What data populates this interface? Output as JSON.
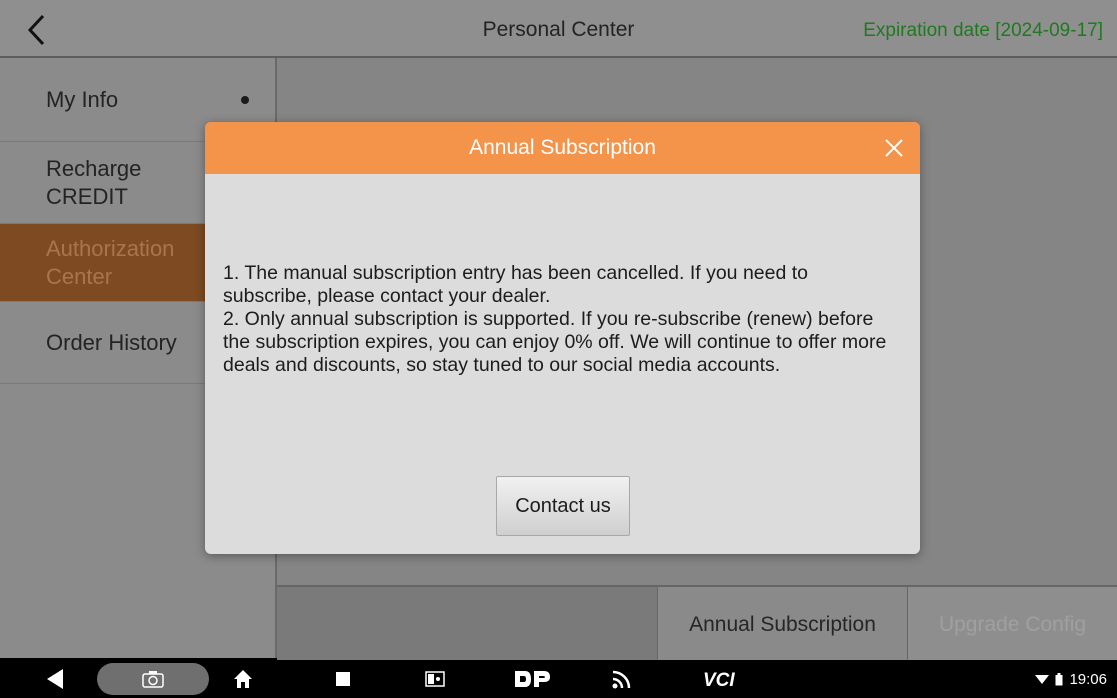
{
  "header": {
    "title": "Personal Center",
    "expiration": "Expiration date [2024-09-17]"
  },
  "sidebar": {
    "items": [
      {
        "label": "My Info",
        "has_dot": true
      },
      {
        "label": "Recharge\nCREDIT"
      },
      {
        "label": "Authorization\nCenter",
        "active": true
      },
      {
        "label": "Order History"
      }
    ]
  },
  "tabs": {
    "annual": "Annual Subscription",
    "upgrade": "Upgrade Config"
  },
  "dialog": {
    "title": "Annual Subscription",
    "paragraph1": "1. The manual subscription entry has been cancelled. If you need to subscribe, please contact your dealer.",
    "paragraph2": "2. Only annual subscription is supported. If you re-subscribe (renew) before the subscription expires, you can enjoy 0% off. We will continue to offer more deals and discounts, so stay tuned to our social media accounts.",
    "contact_button": "Contact us"
  },
  "navbar": {
    "vci_label": "VCI",
    "time": "19:06",
    "icons": [
      "back-triangle-icon",
      "camera-icon",
      "home-icon",
      "recent-apps-icon",
      "screen-mirror-icon",
      "dp-logo-icon",
      "cast-signal-icon",
      "vci-icon",
      "wifi-icon",
      "battery-icon"
    ]
  },
  "colors": {
    "accent_orange": "#f4934a",
    "active_item_bg": "#7d4a22",
    "expiry_green": "#1f7a1f"
  }
}
